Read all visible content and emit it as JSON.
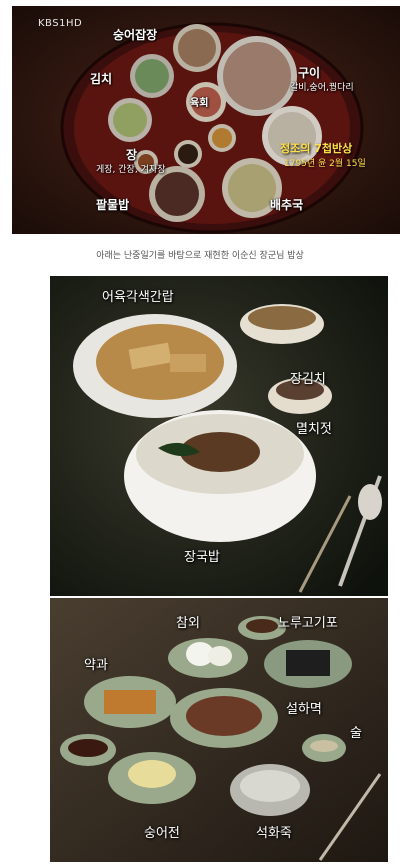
{
  "photo1": {
    "logo": "KBS1HD",
    "labels": {
      "jangajji": "숭어잡장",
      "kimchi": "김치",
      "gui": "구이",
      "gui_sub": "갈비,숭어,꿩다리",
      "yukhoe": "육회",
      "jang": "장",
      "jang_sub": "게장, 간장, 겨자장",
      "patmulbap": "팥물밥",
      "baechuguk": "배추국"
    },
    "banner_title": "정조의 7첩반상",
    "banner_date": "1795년 윤 2월 15일"
  },
  "caption": "아래는 난중일기를 바탕으로 재현한 이순신 장군님 밥상",
  "photo2": {
    "labels": {
      "title": "어육각색간랍",
      "jangkimchi": "장김치",
      "myeolchijeot": "멸치젓",
      "janggukbap": "장국밥"
    }
  },
  "photo3": {
    "labels": {
      "chamoe": "참외",
      "norugogipo": "노루고기포",
      "yakgwa": "약과",
      "seolhamyeok": "설하멱",
      "sul": "술",
      "sungeojeon": "숭어전",
      "seokhwajuk": "석화죽"
    }
  }
}
